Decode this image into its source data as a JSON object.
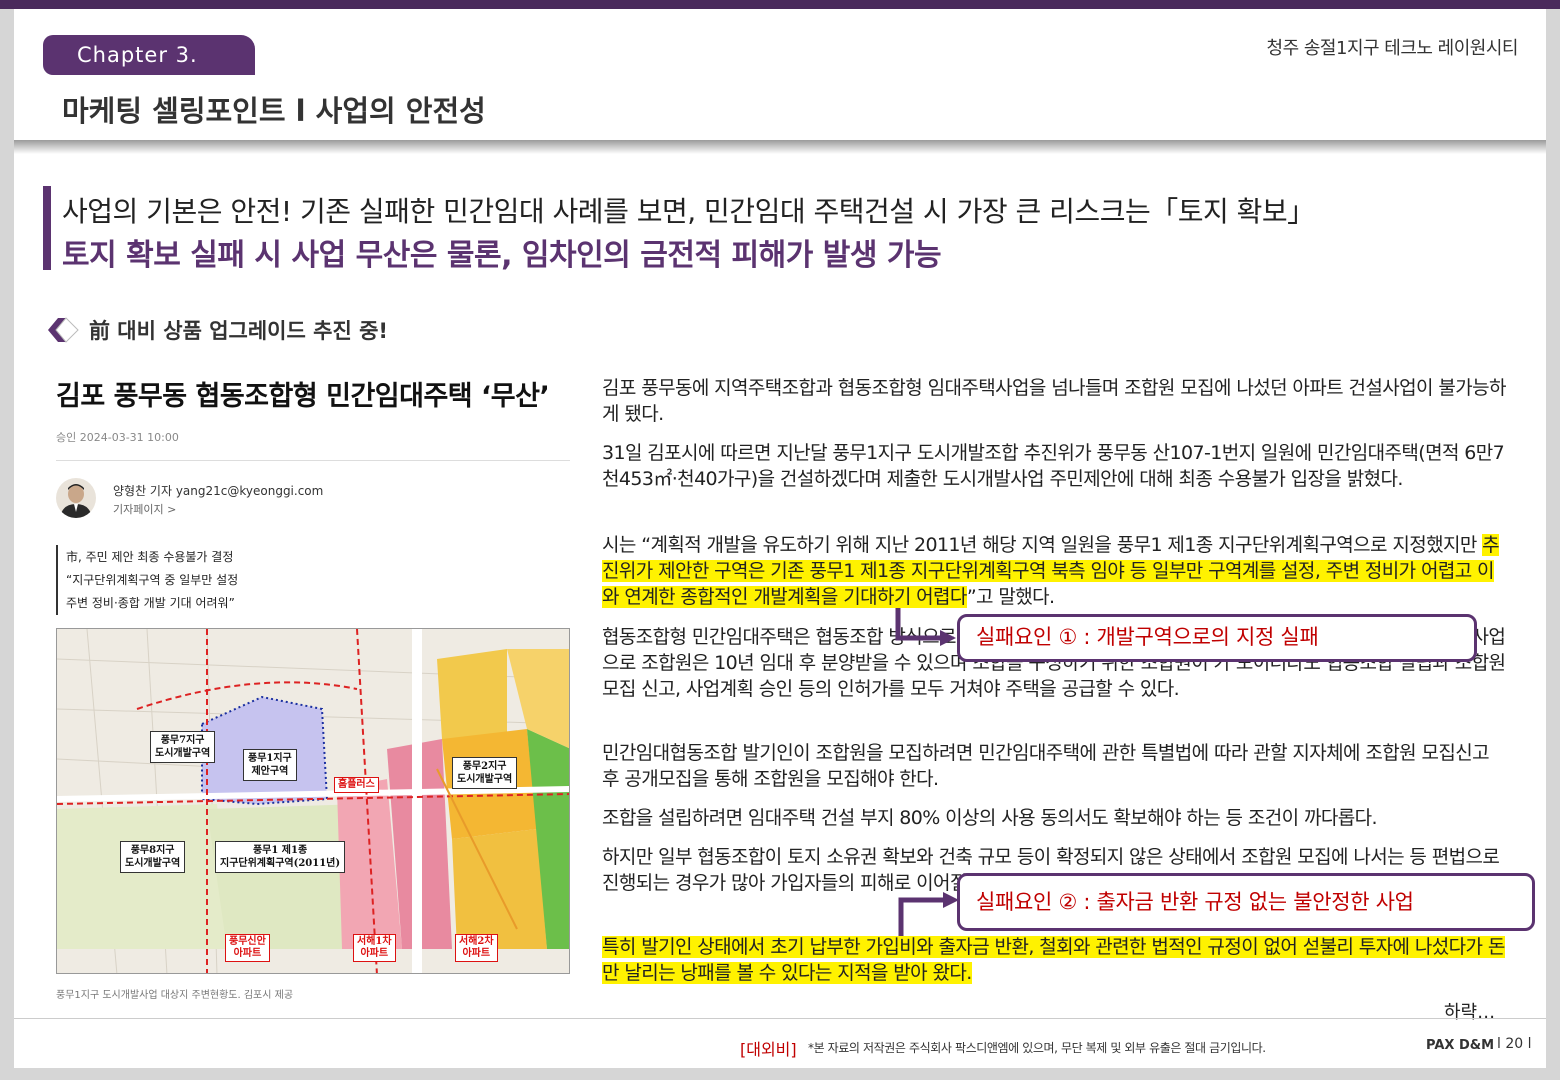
{
  "header": {
    "chapter": "Chapter 3.",
    "title": "마케팅 셀링포인트 l 사업의 안전성",
    "brand": "청주 송절1지구 테크노 레이원시티"
  },
  "headline": {
    "line1": "사업의 기본은 안전! 기존 실패한 민간임대 사례를 보면, 민간임대 주택건설 시 가장 큰 리스크는「토지 확보」",
    "line2": "토지 확보 실패 시 사업 무산은 물론, 임차인의 금전적 피해가 발생 가능"
  },
  "section": {
    "label": "前 대비 상품 업그레이드 추진 중!"
  },
  "article": {
    "title": "김포 풍무동 협동조합형 민간임대주택 ‘무산’",
    "date": "승인  2024-03-31 10:00",
    "reporter": "양형찬 기자  yang21c@kyeonggi.com",
    "reporter_page": "기자페이지 >",
    "summary": [
      "市, 주민 제안 최종 수용불가 결정",
      "“지구단위계획구역 중 일부만 설정",
      "주변 정비·종합 개발 기대 어려워”"
    ],
    "map_labels": {
      "district7": "풍무7지구\n도시개발구역",
      "district1": "풍무1지구\n제안구역",
      "district2": "풍무2지구\n도시개발구역",
      "district8": "풍무8지구\n도시개발구역",
      "zone1": "풍무1 제1종\n지구단위계획구역(2011년)",
      "apt1": "풍무신안\n아파트",
      "apt2": "서해1차\n아파트",
      "apt3": "서해2차\n아파트",
      "mall": "홈플러스"
    },
    "map_caption": "풍무1지구 도시개발사업 대상지 주변현황도. 김포시 제공"
  },
  "body": {
    "p1": "김포 풍무동에 지역주택조합과 협동조합형 임대주택사업을 넘나들며 조합원 모집에 나섰던 아파트 건설사업이 불가능하게 됐다.",
    "p2": " 31일 김포시에 따르면 지난달 풍무1지구 도시개발조합 추진위가 풍무동 산107-1번지 일원에 민간임대주택(면적 6만7천453㎡·천40가구)을 건설하겠다며 제출한 도시개발사업 주민제안에 대해 최종 수용불가 입장을 밝혔다.",
    "p3_pre": " 시는 “계획적 개발을 유도하기 위해 지난 2011년 해당 지역 일원을 풍무1 제1종 지구단위계획구역으로 지정했지만 ",
    "p3_hl": "추진위가 제안한 구역은 기존 풍무1 제1종 지구단위계획구역 북측 임야 등 일부만 구역계를 설정, 주변 정비가 어렵고 이와 연계한 종합적인 개발계획을 기대하기 어렵다",
    "p3_post": "”고 말했다.",
    "p4": " 협동조합형 민간임대주택은 협동조합 방식으로 무주택 서민들이 모여 일정 기간 임대 후 조합원에게 우선 공급하는 사업으로 조합원은 10년 임대 후 분양받을 수 있으며 조합을 구성하기 위한 조합원이 가 모이더라도 협동조합 설립과 조합원 모집 신고, 사업계획 승인 등의 인허가를 모두 거쳐야 주택을 공급할 수 있다.",
    "p5": " 민간임대협동조합 발기인이 조합원을 모집하려면 민간임대주택에 관한 특별법에 따라 관할 지자체에 조합원 모집신고 후 공개모집을 통해 조합원을 모집해야 한다.",
    "p6": " 조합을 설립하려면 임대주택 건설 부지 80% 이상의 사용 동의서도 확보해야 하는 등 조건이 까다롭다.",
    "p7": " 하지만 일부 협동조합이 토지 소유권 확보와 건축 규모 등이 확정되지 않은 상태에서 조합원 모집에 나서는 등 편법으로 진행되는 경우가 많아 가입자들의 피해로 이어질 수 있어 주의가 요구될 가능성이 높다.",
    "p8": " 특히 발기인 상태에서 초기 납부한 가입비와 출자금 반환, 철회와 관련한 법적인 규정이 없어 섣불리 투자에 나섰다가 돈만 날리는 낭패를 볼 수 있다는 지적을 받아 왔다.",
    "more": "하략…"
  },
  "callouts": {
    "c1": "실패요인 ① : 개발구역으로의 지정 실패",
    "c2": "실패요인 ② : 출자금 반환 규정 없는 불안정한 사업"
  },
  "footer": {
    "confidential": "[대외비]",
    "note": "*본 자료의 저작권은 주식회사 팍스디앤엠에 있으며, 무단 복제 및 외부 유출은 절대 금기입니다.",
    "brand": "PAX D&M",
    "page": "l 20 l"
  },
  "colors": {
    "accent": "#5b3370",
    "highlight": "#fff200",
    "callout_text": "#c00000"
  }
}
